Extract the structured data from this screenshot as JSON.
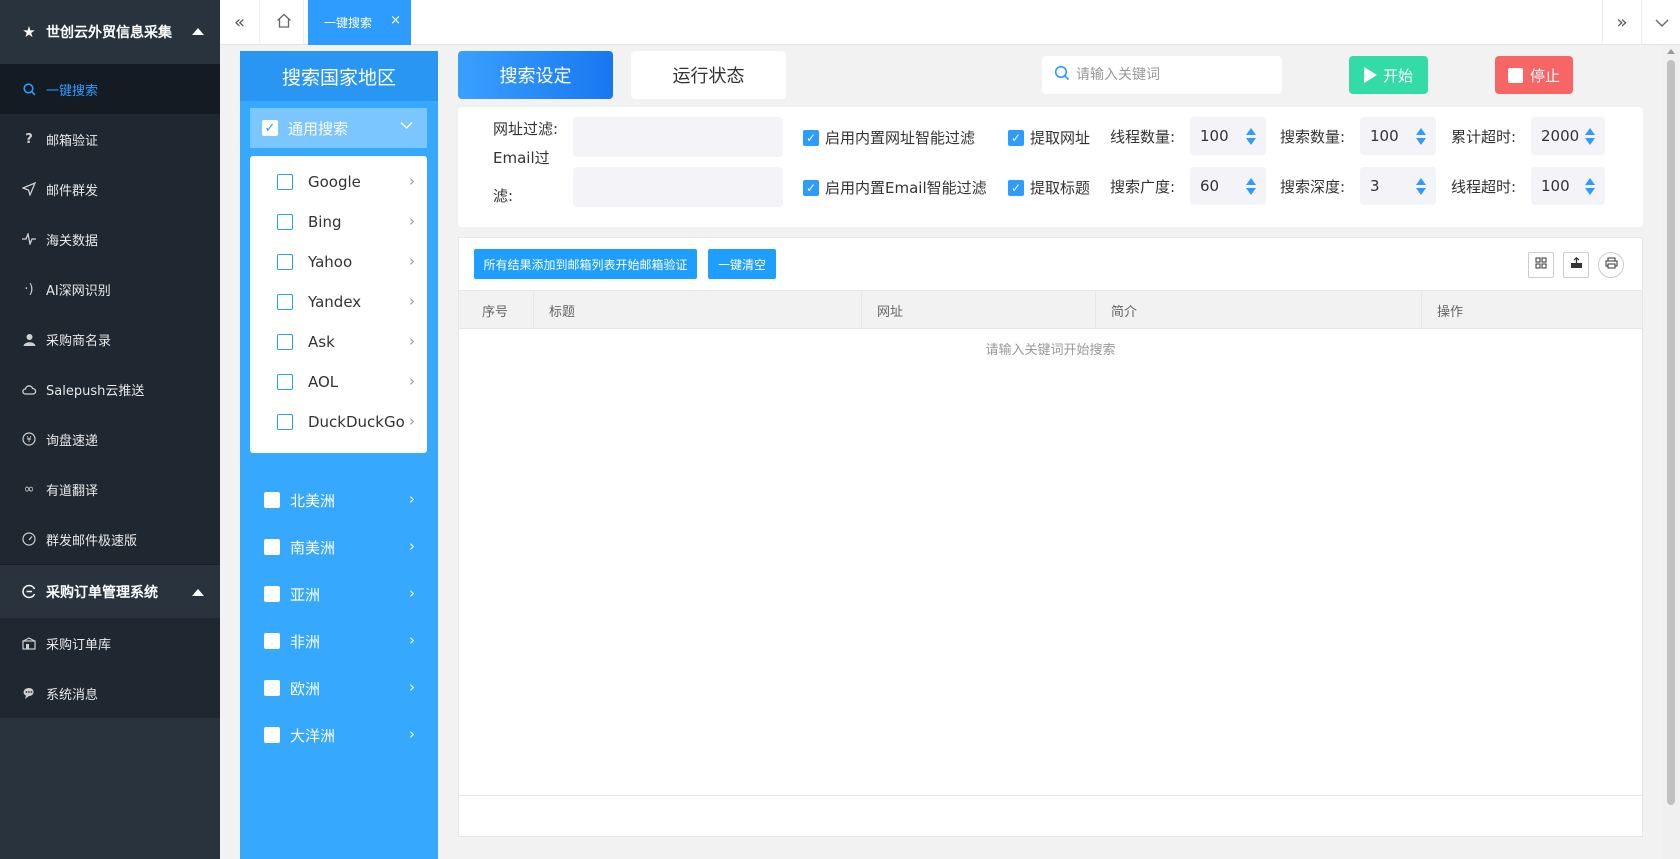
{
  "sidebar": {
    "group1": {
      "title": "世创云外贸信息采集",
      "icon": "star-icon",
      "items": [
        {
          "label": "一键搜索",
          "icon": "search-icon",
          "active": true
        },
        {
          "label": "邮箱验证",
          "icon": "question-icon"
        },
        {
          "label": "邮件群发",
          "icon": "send-icon"
        },
        {
          "label": "海关数据",
          "icon": "pulse-icon"
        },
        {
          "label": "AI深网识别",
          "icon": "signal-icon"
        },
        {
          "label": "采购商名录",
          "icon": "user-icon"
        },
        {
          "label": "Salepush云推送",
          "icon": "cloud-icon"
        },
        {
          "label": "询盘速递",
          "icon": "yen-icon"
        },
        {
          "label": "有道翻译",
          "icon": "link-icon"
        },
        {
          "label": "群发邮件极速版",
          "icon": "gauge-icon"
        }
      ]
    },
    "group2": {
      "title": "采购订单管理系统",
      "icon": "cycle-icon",
      "items": [
        {
          "label": "采购订单库",
          "icon": "warehouse-icon"
        },
        {
          "label": "系统消息",
          "icon": "chat-icon"
        }
      ]
    }
  },
  "topbar": {
    "tab_label": "一键搜索",
    "close_glyph": "×"
  },
  "region": {
    "title": "搜索国家地区",
    "general_label": "通用搜索",
    "engines": [
      "Google",
      "Bing",
      "Yahoo",
      "Yandex",
      "Ask",
      "AOL",
      "DuckDuckGo"
    ],
    "continents": [
      "北美洲",
      "南美洲",
      "亚洲",
      "非洲",
      "欧洲",
      "大洋洲"
    ]
  },
  "main": {
    "tab_settings": "搜索设定",
    "tab_status": "运行状态",
    "search_placeholder": "请输入关键词",
    "start_label": "开始",
    "stop_label": "停止"
  },
  "settings": {
    "url_filter_label": "网址过滤:",
    "email_filter_label_1": "Email过",
    "email_filter_label_2": "滤:",
    "opt_url_smart": "启用内置网址智能过滤",
    "opt_email_smart": "启用内置Email智能过滤",
    "opt_extract_url": "提取网址",
    "opt_extract_title": "提取标题",
    "thread_count_label": "线程数量:",
    "thread_count": "100",
    "search_count_label": "搜索数量:",
    "search_count": "100",
    "total_timeout_label": "累计超时:",
    "total_timeout": "2000",
    "search_breadth_label": "搜索广度:",
    "search_breadth": "60",
    "search_depth_label": "搜索深度:",
    "search_depth": "3",
    "thread_timeout_label": "线程超时:",
    "thread_timeout": "100"
  },
  "results": {
    "add_all_label": "所有结果添加到邮箱列表开始邮箱验证",
    "clear_label": "一键清空",
    "tools": [
      "columns-icon",
      "export-icon",
      "print-icon"
    ],
    "columns": [
      "序号",
      "标题",
      "网址",
      "简介",
      "操作"
    ],
    "empty_text": "请输入关键词开始搜索"
  },
  "colors": {
    "sidebar_bg": "#28333e",
    "accent": "#2e9bff",
    "region_bg": "#36a9ff",
    "start": "#33dba6",
    "stop": "#f76565"
  }
}
